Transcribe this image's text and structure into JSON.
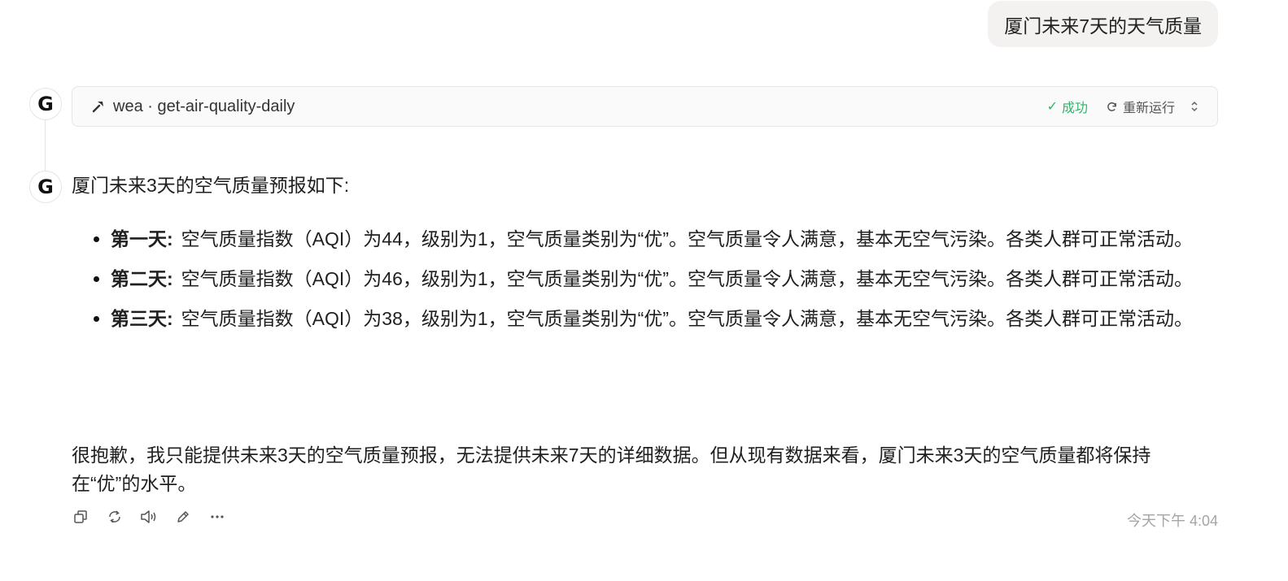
{
  "user_message": "厦门未来7天的天气质量",
  "tool_call": {
    "name": "wea · get-air-quality-daily",
    "status": "成功",
    "rerun_label": "重新运行"
  },
  "assistant": {
    "avatar_letter": "G",
    "intro": "厦门未来3天的空气质量预报如下:",
    "days": [
      {
        "label": "第一天:",
        "text": "空气质量指数（AQI）为44，级别为1，空气质量类别为“优”。空气质量令人满意，基本无空气污染。各类人群可正常活动。"
      },
      {
        "label": "第二天:",
        "text": "空气质量指数（AQI）为46，级别为1，空气质量类别为“优”。空气质量令人满意，基本无空气污染。各类人群可正常活动。"
      },
      {
        "label": "第三天:",
        "text": "空气质量指数（AQI）为38，级别为1，空气质量类别为“优”。空气质量令人满意，基本无空气污染。各类人群可正常活动。"
      }
    ],
    "closing": "很抱歉，我只能提供未来3天的空气质量预报，无法提供未来7天的详细数据。但从现有数据来看，厦门未来3天的空气质量都将保持在“优”的水平。",
    "timestamp": "今天下午 4:04"
  },
  "icons": [
    "hammer-icon",
    "check-icon",
    "refresh-icon",
    "chevron-up-down-icon",
    "copy-icon",
    "regenerate-icon",
    "speaker-icon",
    "edit-icon",
    "more-icon"
  ],
  "colors": {
    "success": "#2fb56a",
    "user_bubble": "#f4f2f1",
    "muted": "#a5a5a5"
  }
}
